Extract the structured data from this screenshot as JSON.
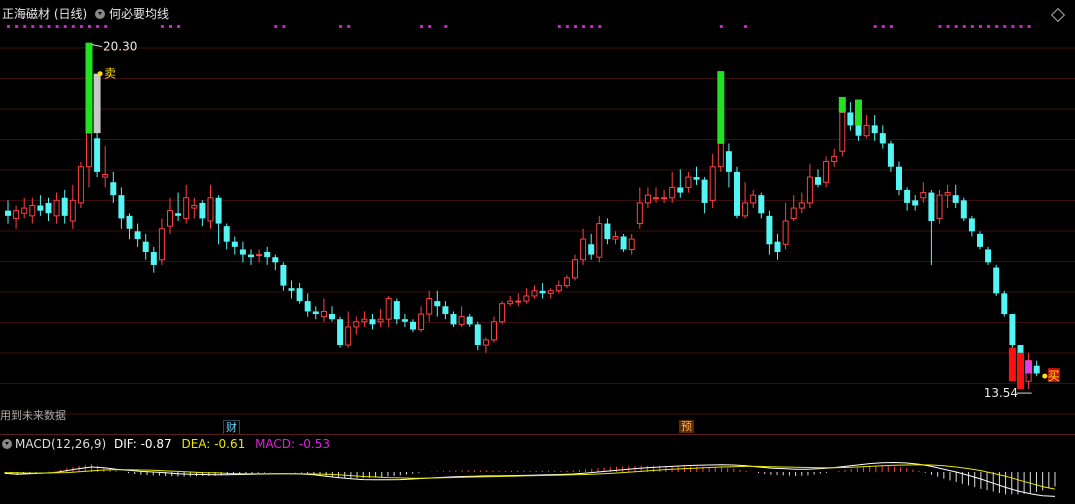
{
  "header": {
    "title": "正海磁材 (日线)",
    "indicator": "何必要均线"
  },
  "footnote": "用到未来数据",
  "badges": {
    "finance": "财",
    "forecast": "预"
  },
  "macd": {
    "label": "MACD(12,26,9)",
    "dif_label": "DIF:",
    "dif": "-0.87",
    "dea_label": "DEA:",
    "dea": "-0.61",
    "macd_label": "MACD:",
    "macd": "-0.53",
    "dif_color": "#ffffff",
    "dea_color": "#e8e800",
    "macd_color": "#e020e0"
  },
  "colors": {
    "up": "#ff4040",
    "down": "#54f5f5",
    "sell_bar": "#22e022",
    "buy_bar": "#ff1010",
    "gray_bar": "#c8c8c8",
    "magenta_dots": "#d020d0",
    "grid": "#3a0e0e"
  },
  "chart_data": {
    "type": "candlestick",
    "y_range": [
      13.0,
      20.7
    ],
    "annotations": {
      "high_label": "20.30",
      "high_value": 20.3,
      "high_index": 10,
      "low_label": "13.54",
      "low_value": 13.54,
      "low_index": 127,
      "sell_label": "卖",
      "buy_label": "买",
      "sell_index": 11,
      "buy_index": 128
    },
    "candles": [
      [
        17.05,
        16.95,
        17.25,
        16.8
      ],
      [
        16.9,
        17.05,
        17.15,
        16.7
      ],
      [
        17.0,
        17.1,
        17.3,
        16.9
      ],
      [
        16.95,
        17.15,
        17.3,
        16.8
      ],
      [
        17.15,
        17.05,
        17.35,
        16.95
      ],
      [
        17.2,
        17.0,
        17.3,
        16.85
      ],
      [
        16.95,
        17.25,
        17.4,
        16.8
      ],
      [
        17.3,
        16.95,
        17.45,
        16.8
      ],
      [
        16.85,
        17.25,
        17.55,
        16.7
      ],
      [
        17.2,
        17.9,
        18.0,
        17.1
      ],
      [
        17.9,
        18.55,
        19.3,
        17.5
      ],
      [
        18.45,
        17.8,
        18.6,
        17.7
      ],
      [
        17.7,
        17.75,
        18.3,
        17.5
      ],
      [
        17.6,
        17.35,
        17.8,
        17.2
      ],
      [
        17.35,
        16.9,
        17.5,
        16.7
      ],
      [
        16.95,
        16.7,
        17.0,
        16.5
      ],
      [
        16.65,
        16.5,
        16.8,
        16.35
      ],
      [
        16.45,
        16.25,
        16.6,
        16.1
      ],
      [
        16.25,
        16.0,
        16.35,
        15.85
      ],
      [
        16.1,
        16.7,
        16.9,
        16.0
      ],
      [
        16.75,
        17.05,
        17.3,
        16.6
      ],
      [
        17.0,
        16.95,
        17.4,
        16.85
      ],
      [
        16.9,
        17.3,
        17.55,
        16.8
      ],
      [
        17.1,
        17.15,
        17.3,
        16.9
      ],
      [
        17.2,
        16.9,
        17.25,
        16.75
      ],
      [
        16.85,
        17.3,
        17.55,
        16.7
      ],
      [
        17.3,
        16.8,
        17.35,
        16.4
      ],
      [
        16.75,
        16.45,
        16.8,
        16.3
      ],
      [
        16.45,
        16.35,
        16.55,
        16.2
      ],
      [
        16.3,
        16.2,
        16.45,
        16.05
      ],
      [
        16.2,
        16.15,
        16.3,
        16.0
      ],
      [
        16.2,
        16.2,
        16.3,
        16.05
      ],
      [
        16.25,
        16.15,
        16.35,
        16.0
      ],
      [
        16.15,
        16.05,
        16.2,
        15.9
      ],
      [
        16.0,
        15.6,
        16.05,
        15.5
      ],
      [
        15.55,
        15.5,
        15.7,
        15.35
      ],
      [
        15.55,
        15.3,
        15.65,
        15.25
      ],
      [
        15.3,
        15.1,
        15.45,
        15.0
      ],
      [
        15.1,
        15.05,
        15.2,
        14.95
      ],
      [
        15.0,
        15.1,
        15.35,
        14.9
      ],
      [
        15.05,
        14.95,
        15.2,
        14.9
      ],
      [
        14.95,
        14.45,
        15.0,
        14.4
      ],
      [
        14.45,
        14.8,
        15.1,
        14.4
      ],
      [
        14.8,
        14.9,
        15.0,
        14.65
      ],
      [
        14.9,
        14.95,
        15.1,
        14.8
      ],
      [
        14.95,
        14.85,
        15.05,
        14.75
      ],
      [
        14.9,
        14.95,
        15.15,
        14.8
      ],
      [
        14.95,
        15.35,
        15.4,
        14.8
      ],
      [
        15.3,
        14.95,
        15.35,
        14.85
      ],
      [
        14.95,
        14.9,
        15.05,
        14.8
      ],
      [
        14.9,
        14.75,
        14.95,
        14.7
      ],
      [
        14.75,
        15.05,
        15.2,
        14.7
      ],
      [
        15.05,
        15.35,
        15.5,
        14.9
      ],
      [
        15.3,
        15.2,
        15.5,
        15.0
      ],
      [
        15.2,
        15.05,
        15.3,
        14.95
      ],
      [
        15.05,
        14.85,
        15.1,
        14.8
      ],
      [
        14.85,
        15.0,
        15.2,
        14.8
      ],
      [
        15.0,
        14.85,
        15.05,
        14.8
      ],
      [
        14.85,
        14.45,
        14.9,
        14.35
      ],
      [
        14.45,
        14.55,
        14.6,
        14.3
      ],
      [
        14.55,
        14.9,
        15.0,
        14.5
      ],
      [
        14.9,
        15.25,
        15.3,
        14.85
      ],
      [
        15.25,
        15.3,
        15.4,
        15.2
      ],
      [
        15.3,
        15.3,
        15.45,
        15.2
      ],
      [
        15.3,
        15.4,
        15.55,
        15.25
      ],
      [
        15.4,
        15.5,
        15.6,
        15.35
      ],
      [
        15.5,
        15.45,
        15.65,
        15.35
      ],
      [
        15.45,
        15.5,
        15.55,
        15.35
      ],
      [
        15.5,
        15.6,
        15.7,
        15.45
      ],
      [
        15.6,
        15.75,
        15.8,
        15.55
      ],
      [
        15.75,
        16.1,
        16.2,
        15.7
      ],
      [
        16.1,
        16.5,
        16.7,
        16.0
      ],
      [
        16.4,
        16.2,
        16.6,
        16.1
      ],
      [
        16.15,
        16.8,
        16.95,
        16.05
      ],
      [
        16.8,
        16.5,
        16.9,
        16.4
      ],
      [
        16.5,
        16.55,
        16.65,
        16.4
      ],
      [
        16.55,
        16.3,
        16.6,
        16.25
      ],
      [
        16.3,
        16.5,
        16.6,
        16.2
      ],
      [
        16.8,
        17.2,
        17.5,
        16.7
      ],
      [
        17.2,
        17.35,
        17.5,
        17.1
      ],
      [
        17.3,
        17.3,
        17.5,
        17.2
      ],
      [
        17.3,
        17.3,
        17.45,
        17.2
      ],
      [
        17.3,
        17.5,
        17.8,
        17.2
      ],
      [
        17.5,
        17.4,
        17.85,
        17.3
      ],
      [
        17.5,
        17.7,
        17.8,
        17.4
      ],
      [
        17.7,
        17.65,
        17.9,
        17.55
      ],
      [
        17.65,
        17.2,
        17.7,
        17.0
      ],
      [
        17.25,
        17.9,
        18.15,
        17.1
      ],
      [
        17.9,
        18.35,
        19.2,
        17.8
      ],
      [
        18.2,
        17.8,
        18.35,
        17.5
      ],
      [
        17.8,
        16.95,
        17.9,
        16.9
      ],
      [
        16.95,
        17.2,
        17.6,
        16.9
      ],
      [
        17.2,
        17.35,
        17.45,
        17.1
      ],
      [
        17.35,
        17.0,
        17.4,
        16.9
      ],
      [
        16.95,
        16.4,
        17.05,
        16.2
      ],
      [
        16.45,
        16.25,
        16.6,
        16.1
      ],
      [
        16.4,
        16.85,
        17.2,
        16.3
      ],
      [
        16.9,
        17.1,
        17.35,
        16.85
      ],
      [
        17.1,
        17.2,
        17.4,
        17.0
      ],
      [
        17.2,
        17.7,
        17.95,
        17.1
      ],
      [
        17.7,
        17.55,
        17.85,
        17.5
      ],
      [
        17.6,
        18.0,
        18.1,
        17.5
      ],
      [
        18.0,
        18.1,
        18.25,
        17.9
      ],
      [
        18.2,
        18.95,
        19.1,
        18.1
      ],
      [
        18.95,
        18.7,
        19.15,
        18.6
      ],
      [
        18.7,
        18.5,
        18.9,
        18.4
      ],
      [
        18.5,
        18.7,
        18.9,
        18.45
      ],
      [
        18.7,
        18.55,
        18.9,
        18.4
      ],
      [
        18.55,
        18.35,
        18.7,
        18.25
      ],
      [
        18.35,
        17.9,
        18.4,
        17.8
      ],
      [
        17.9,
        17.45,
        18.0,
        17.35
      ],
      [
        17.45,
        17.2,
        17.5,
        17.05
      ],
      [
        17.25,
        17.15,
        17.35,
        17.05
      ],
      [
        17.3,
        17.4,
        17.6,
        17.2
      ],
      [
        17.4,
        16.85,
        17.45,
        16.0
      ],
      [
        16.9,
        17.35,
        17.45,
        16.8
      ],
      [
        17.35,
        17.4,
        17.55,
        17.1
      ],
      [
        17.35,
        17.2,
        17.55,
        17.1
      ],
      [
        17.25,
        16.9,
        17.3,
        16.85
      ],
      [
        16.9,
        16.65,
        16.95,
        16.55
      ],
      [
        16.6,
        16.35,
        16.65,
        16.3
      ],
      [
        16.3,
        16.05,
        16.35,
        16.0
      ],
      [
        15.95,
        15.45,
        16.0,
        15.4
      ],
      [
        15.45,
        15.05,
        15.5,
        15.0
      ],
      [
        15.05,
        14.45,
        15.05,
        14.4
      ],
      [
        14.45,
        13.7,
        14.45,
        13.65
      ],
      [
        13.75,
        14.15,
        14.3,
        13.6
      ],
      [
        14.05,
        13.9,
        14.15,
        13.85
      ]
    ],
    "signal_bars": [
      {
        "index": 10,
        "type": "sell",
        "from": 18.55,
        "to": 20.3
      },
      {
        "index": 11,
        "type": "gray",
        "from": 18.55,
        "to": 19.7
      },
      {
        "index": 88,
        "type": "sell",
        "from": 18.35,
        "to": 19.75
      },
      {
        "index": 103,
        "type": "sell",
        "from": 18.95,
        "to": 19.25
      },
      {
        "index": 105,
        "type": "sell",
        "from": 18.7,
        "to": 19.2
      },
      {
        "index": 124,
        "type": "buy",
        "from": 13.75,
        "to": 14.4
      },
      {
        "index": 125,
        "type": "buy",
        "from": 13.6,
        "to": 14.3
      },
      {
        "index": 126,
        "type": "buy_magenta",
        "from": 13.9,
        "to": 14.15
      }
    ],
    "top_dot_indices": [
      0,
      1,
      2,
      3,
      4,
      5,
      6,
      7,
      8,
      9,
      10,
      11,
      12,
      19,
      20,
      21,
      33,
      34,
      41,
      42,
      51,
      52,
      54,
      68,
      69,
      70,
      71,
      72,
      73,
      88,
      91,
      107,
      108,
      109,
      115,
      116,
      117,
      118,
      119,
      120,
      121,
      122,
      123,
      124,
      125,
      126
    ],
    "macd": {
      "dif": [
        -0.05,
        -0.08,
        -0.06,
        -0.04,
        -0.02,
        0.05,
        0.12,
        0.18,
        0.15,
        0.1,
        0.06,
        0.02,
        0.0,
        -0.03,
        -0.06,
        -0.08,
        -0.09,
        -0.1,
        -0.1,
        -0.09,
        -0.08,
        -0.07,
        -0.06,
        -0.06,
        -0.07,
        -0.1,
        -0.15,
        -0.2,
        -0.24,
        -0.27,
        -0.28,
        -0.28,
        -0.27,
        -0.25,
        -0.22,
        -0.2,
        -0.18,
        -0.16,
        -0.15,
        -0.14,
        -0.14,
        -0.13,
        -0.12,
        -0.11,
        -0.1,
        -0.09,
        -0.07,
        -0.04,
        0.0,
        0.04,
        0.08,
        0.12,
        0.15,
        0.18,
        0.2,
        0.22,
        0.24,
        0.25,
        0.26,
        0.25,
        0.22,
        0.18,
        0.14,
        0.12,
        0.1,
        0.1,
        0.12,
        0.15,
        0.2,
        0.25,
        0.3,
        0.33,
        0.34,
        0.32,
        0.28,
        0.2,
        0.1,
        0.0,
        -0.12,
        -0.25,
        -0.4,
        -0.55,
        -0.68,
        -0.78,
        -0.85,
        -0.87
      ],
      "dea": [
        -0.02,
        -0.03,
        -0.04,
        -0.04,
        -0.03,
        -0.02,
        0.01,
        0.04,
        0.07,
        0.08,
        0.08,
        0.07,
        0.06,
        0.04,
        0.02,
        0.0,
        -0.02,
        -0.03,
        -0.05,
        -0.06,
        -0.06,
        -0.06,
        -0.06,
        -0.06,
        -0.06,
        -0.07,
        -0.08,
        -0.1,
        -0.13,
        -0.16,
        -0.18,
        -0.2,
        -0.21,
        -0.22,
        -0.22,
        -0.21,
        -0.2,
        -0.19,
        -0.18,
        -0.17,
        -0.16,
        -0.15,
        -0.14,
        -0.13,
        -0.12,
        -0.11,
        -0.1,
        -0.09,
        -0.07,
        -0.05,
        -0.02,
        0.01,
        0.04,
        0.07,
        0.1,
        0.12,
        0.14,
        0.16,
        0.18,
        0.19,
        0.2,
        0.2,
        0.19,
        0.18,
        0.17,
        0.16,
        0.15,
        0.15,
        0.16,
        0.18,
        0.2,
        0.22,
        0.24,
        0.25,
        0.26,
        0.25,
        0.22,
        0.18,
        0.12,
        0.05,
        -0.05,
        -0.15,
        -0.28,
        -0.4,
        -0.52,
        -0.61
      ]
    }
  }
}
